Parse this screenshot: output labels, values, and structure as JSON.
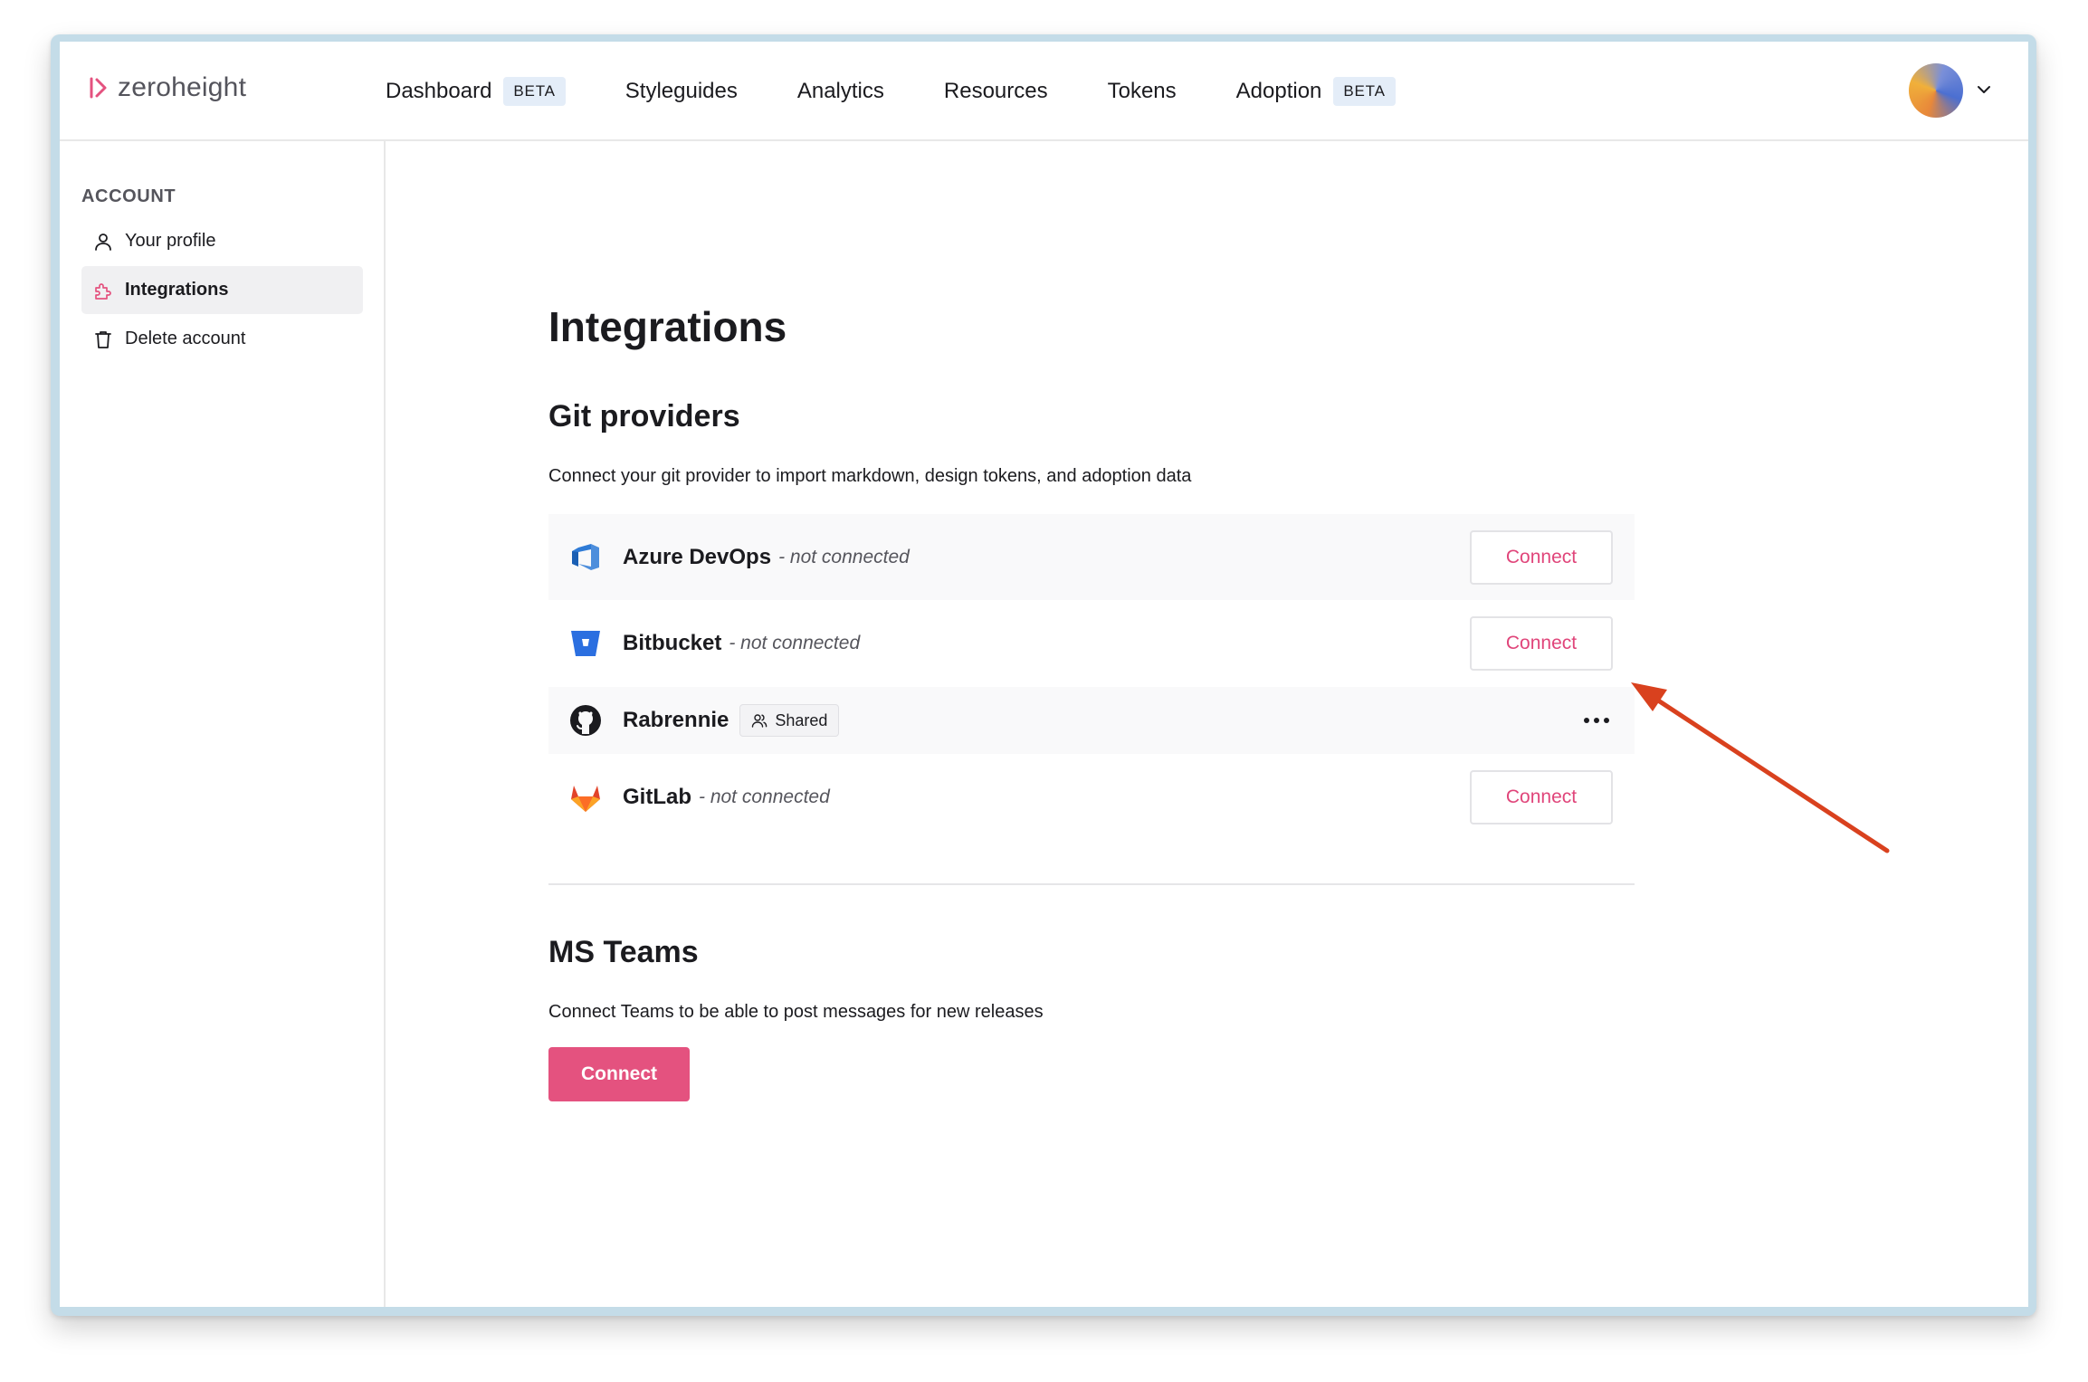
{
  "app": {
    "logo_text": "zeroheight"
  },
  "nav": {
    "items": [
      {
        "label": "Dashboard",
        "badge": "BETA"
      },
      {
        "label": "Styleguides"
      },
      {
        "label": "Analytics"
      },
      {
        "label": "Resources"
      },
      {
        "label": "Tokens"
      },
      {
        "label": "Adoption",
        "badge": "BETA"
      }
    ]
  },
  "sidebar": {
    "header": "ACCOUNT",
    "items": [
      {
        "label": "Your profile",
        "icon": "user-icon"
      },
      {
        "label": "Integrations",
        "icon": "puzzle-icon",
        "active": true
      },
      {
        "label": "Delete account",
        "icon": "trash-icon"
      }
    ]
  },
  "main": {
    "title": "Integrations",
    "git": {
      "title": "Git providers",
      "description": "Connect your git provider to import markdown, design tokens, and adoption data",
      "providers": [
        {
          "name": "Azure DevOps",
          "status": "- not connected",
          "button": "Connect",
          "icon": "azure-devops-icon"
        },
        {
          "name": "Bitbucket",
          "status": "- not connected",
          "button": "Connect",
          "icon": "bitbucket-icon"
        },
        {
          "name": "Rabrennie",
          "badge": "Shared",
          "icon": "github-icon"
        },
        {
          "name": "GitLab",
          "status": "- not connected",
          "button": "Connect",
          "icon": "gitlab-icon"
        }
      ]
    },
    "teams": {
      "title": "MS Teams",
      "description": "Connect Teams to be able to post messages for new releases",
      "button": "Connect"
    }
  },
  "colors": {
    "accent": "#e4527f",
    "accent_text": "#e0457a",
    "annotation_arrow": "#d9411e",
    "beta_badge_bg": "#e4edf8"
  }
}
